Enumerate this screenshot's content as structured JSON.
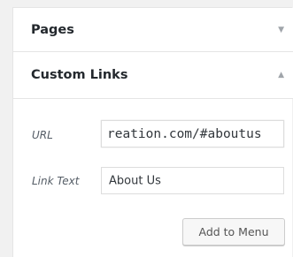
{
  "sections": [
    {
      "title": "Pages",
      "icon": "triangle-down-icon",
      "glyph": "▼"
    },
    {
      "title": "Custom Links",
      "icon": "triangle-up-icon",
      "glyph": "▲"
    }
  ],
  "form": {
    "url_label": "URL",
    "url_value": "reation.com/#aboutus",
    "link_text_label": "Link Text",
    "link_text_value": "About Us",
    "submit_label": "Add to Menu"
  }
}
